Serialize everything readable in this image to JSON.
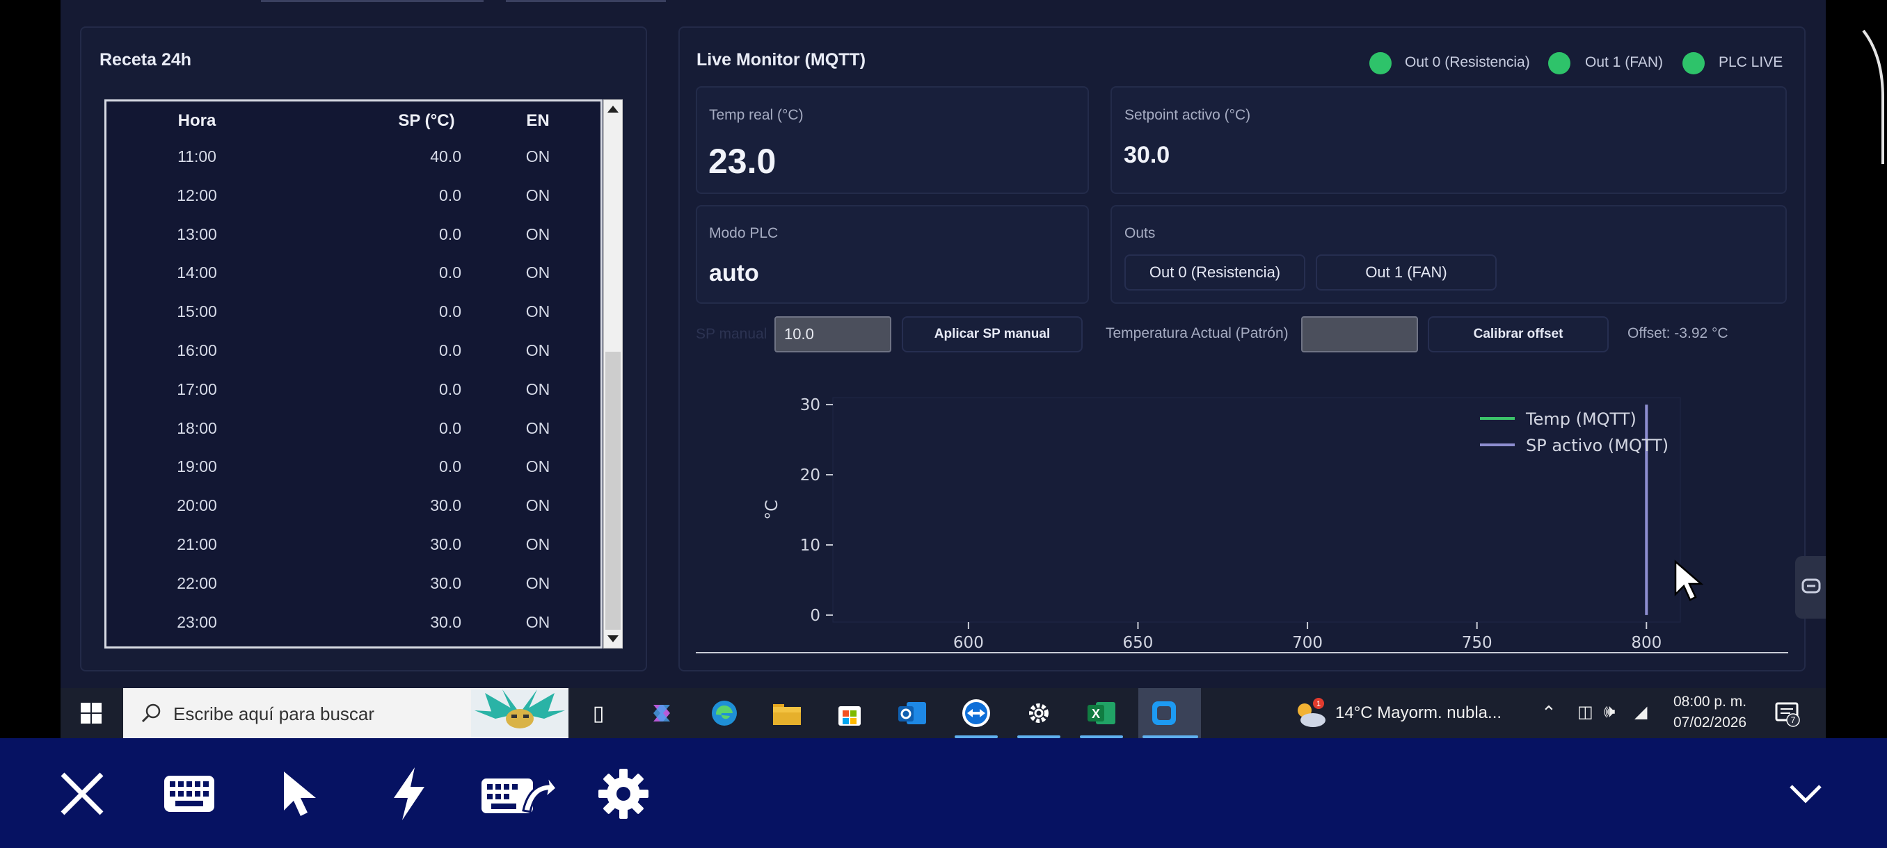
{
  "recipe": {
    "title": "Receta 24h",
    "columns": {
      "hora": "Hora",
      "sp": "SP (°C)",
      "en": "EN"
    },
    "rows": [
      {
        "hora": "11:00",
        "sp": "40.0",
        "en": "ON"
      },
      {
        "hora": "12:00",
        "sp": "0.0",
        "en": "ON"
      },
      {
        "hora": "13:00",
        "sp": "0.0",
        "en": "ON"
      },
      {
        "hora": "14:00",
        "sp": "0.0",
        "en": "ON"
      },
      {
        "hora": "15:00",
        "sp": "0.0",
        "en": "ON"
      },
      {
        "hora": "16:00",
        "sp": "0.0",
        "en": "ON"
      },
      {
        "hora": "17:00",
        "sp": "0.0",
        "en": "ON"
      },
      {
        "hora": "18:00",
        "sp": "0.0",
        "en": "ON"
      },
      {
        "hora": "19:00",
        "sp": "0.0",
        "en": "ON"
      },
      {
        "hora": "20:00",
        "sp": "30.0",
        "en": "ON"
      },
      {
        "hora": "21:00",
        "sp": "30.0",
        "en": "ON"
      },
      {
        "hora": "22:00",
        "sp": "30.0",
        "en": "ON"
      },
      {
        "hora": "23:00",
        "sp": "30.0",
        "en": "ON"
      }
    ]
  },
  "monitor": {
    "title": "Live Monitor (MQTT)",
    "indicators": [
      {
        "label": "Out 0 (Resistencia)",
        "color": "#2ec36a"
      },
      {
        "label": "Out 1 (FAN)",
        "color": "#2ec36a"
      },
      {
        "label": "PLC LIVE",
        "color": "#2ec36a"
      }
    ],
    "temp_real": {
      "label": "Temp real (°C)",
      "value": "23.0"
    },
    "setpoint": {
      "label": "Setpoint activo (°C)",
      "value": "30.0"
    },
    "modo": {
      "label": "Modo PLC",
      "value": "auto"
    },
    "outs": {
      "label": "Outs",
      "buttons": [
        "Out 0 (Resistencia)",
        "Out 1 (FAN)"
      ]
    },
    "sp_manual": {
      "label": "SP manual",
      "value": "10.0",
      "apply": "Aplicar SP manual"
    },
    "calibration": {
      "label": "Temperatura Actual (Patrón)",
      "value": "",
      "button": "Calibrar offset",
      "offset": "Offset: -3.92 °C"
    }
  },
  "chart_data": {
    "type": "line",
    "ylabel": "°C",
    "xlabel": "",
    "xlim": [
      560,
      810
    ],
    "ylim": [
      -1,
      31
    ],
    "x_ticks": [
      600,
      650,
      700,
      750,
      800
    ],
    "y_ticks": [
      0,
      10,
      20,
      30
    ],
    "legend_position": "top-right",
    "series": [
      {
        "name": "Temp (MQTT)",
        "color": "#3cc46a",
        "x": [],
        "y": []
      },
      {
        "name": "SP activo (MQTT)",
        "color": "#8e8ed0",
        "x": [
          800,
          800
        ],
        "y": [
          0,
          30
        ]
      }
    ]
  },
  "taskbar": {
    "search_placeholder": "Escribe aquí para buscar",
    "weather": "14°C  Mayorm. nubla...",
    "weather_badge": "1",
    "time": "08:00 p. m.",
    "date": "07/02/2026",
    "notifications": "7"
  },
  "icons": {
    "remote_bar": [
      "close-icon",
      "keyboard-icon",
      "pointer-icon",
      "lightning-icon",
      "keyboard-send-icon",
      "gear-icon",
      "chevron-down-icon"
    ]
  }
}
